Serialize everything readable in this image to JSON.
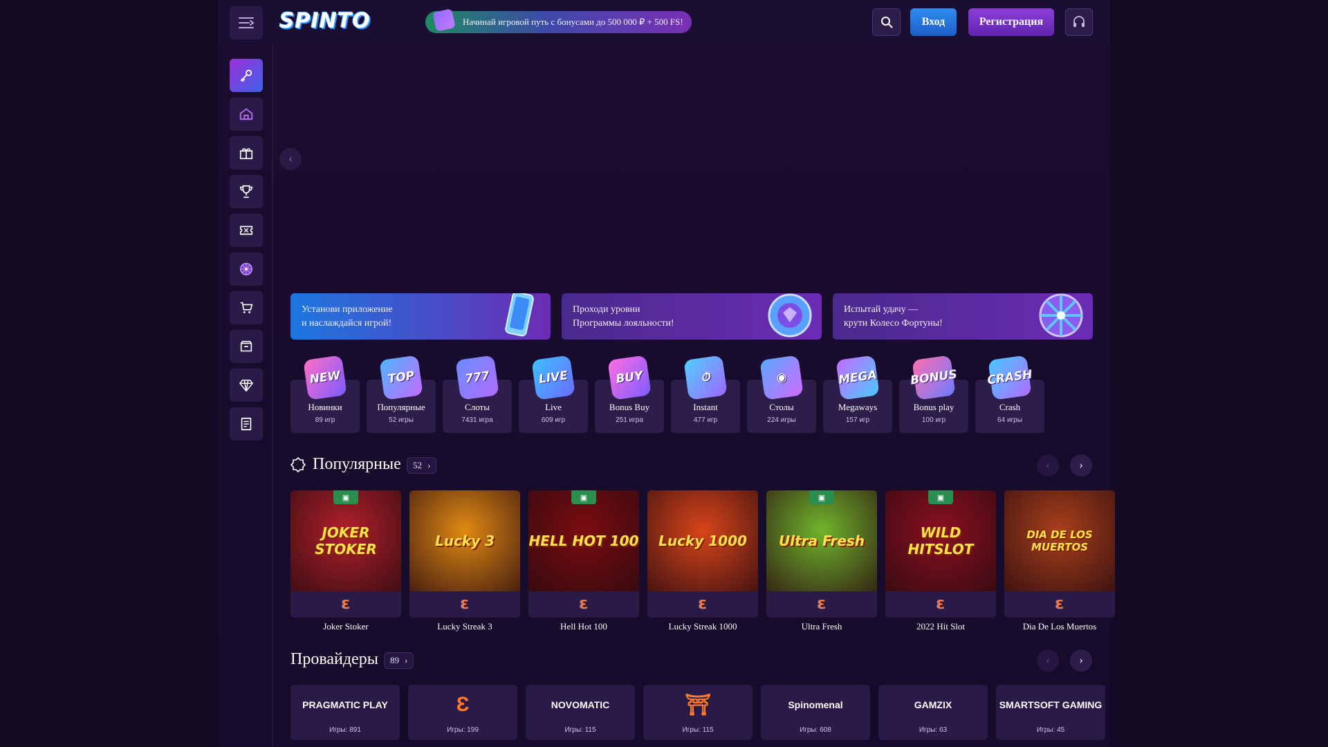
{
  "header": {
    "logo_text": "SPINTO",
    "promo_text": "Начинай игровой путь с бонусами до 500 000 ₽ + 500 FS!",
    "login_label": "Вход",
    "register_label": "Регистрация"
  },
  "sidebar": {
    "items": [
      {
        "icon": "key-icon",
        "active": true
      },
      {
        "icon": "home-icon"
      },
      {
        "icon": "gift-icon"
      },
      {
        "icon": "trophy-icon"
      },
      {
        "icon": "ticket-icon"
      },
      {
        "icon": "wheel-icon"
      },
      {
        "icon": "cart-icon"
      },
      {
        "icon": "box-icon"
      },
      {
        "icon": "diamond-icon"
      },
      {
        "icon": "document-icon"
      }
    ]
  },
  "promo_cards": [
    {
      "text": "Установи приложение\nи наслаждайся игрой!",
      "gradient_start": "#1d77e0",
      "gradient_end": "#6b2cb4"
    },
    {
      "text": "Проходи уровни\nПрограммы лояльности!",
      "gradient_start": "#4a2a8c",
      "gradient_end": "#6b2cb4"
    },
    {
      "text": "Испытай удачу —\nкрути Колесо Фортуны!",
      "gradient_start": "#4a2a8c",
      "gradient_end": "#6b2cb4"
    }
  ],
  "categories": [
    {
      "icon_text": "NEW",
      "label": "Новинки",
      "count": "89 игр"
    },
    {
      "icon_text": "TOP",
      "label": "Популярные",
      "count": "52 игры"
    },
    {
      "icon_text": "777",
      "label": "Слоты",
      "count": "7431 игра"
    },
    {
      "icon_text": "LIVE",
      "label": "Live",
      "count": "609 игр"
    },
    {
      "icon_text": "BUY",
      "label": "Bonus Buy",
      "count": "251 игра"
    },
    {
      "icon_text": "⏱",
      "label": "Instant",
      "count": "477 игр"
    },
    {
      "icon_text": "◉",
      "label": "Столы",
      "count": "224 игры"
    },
    {
      "icon_text": "MEGA",
      "label": "Megaways",
      "count": "157 игр"
    },
    {
      "icon_text": "BONUS",
      "label": "Bonus play",
      "count": "100 игр"
    },
    {
      "icon_text": "CRASH",
      "label": "Crash",
      "count": "64 игры"
    }
  ],
  "popular": {
    "title": "Популярные",
    "count": "52",
    "games": [
      {
        "name": "Joker Stoker",
        "thumb_text": "JOKER STOKER",
        "bg": "#b0202a",
        "gift": true
      },
      {
        "name": "Lucky Streak 3",
        "thumb_text": "Lucky 3",
        "bg": "#e08a12",
        "gift": false
      },
      {
        "name": "Hell Hot 100",
        "thumb_text": "HELL HOT 100",
        "bg": "#7a0c10",
        "gift": true
      },
      {
        "name": "Lucky Streak 1000",
        "thumb_text": "Lucky 1000",
        "bg": "#d8451a",
        "gift": false
      },
      {
        "name": "Ultra Fresh",
        "thumb_text": "Ultra Fresh",
        "bg": "#6fb52c",
        "gift": true
      },
      {
        "name": "2022 Hit Slot",
        "thumb_text": "WILD HITSLOT",
        "bg": "#8a1020",
        "gift": true
      },
      {
        "name": "Dia De Los Muertos",
        "thumb_text": "DIA DE LOS MUERTOS",
        "bg": "#a8401a",
        "gift": false
      }
    ]
  },
  "providers": {
    "title": "Провайдеры",
    "count": "89",
    "items": [
      {
        "logo_text": "PRAGMATIC PLAY",
        "count": "Игры: 891"
      },
      {
        "logo_text": "Ɛ",
        "count": "Игры: 199"
      },
      {
        "logo_text": "NOVOMATIC",
        "count": "Игры: 115"
      },
      {
        "logo_text": "⛩",
        "count": "Игры: 115"
      },
      {
        "logo_text": "Spinomenal",
        "count": "Игры: 608"
      },
      {
        "logo_text": "GAMZIX",
        "count": "Игры: 63"
      },
      {
        "logo_text": "SMARTSOFT GAMING",
        "count": "Игры: 45"
      }
    ]
  }
}
